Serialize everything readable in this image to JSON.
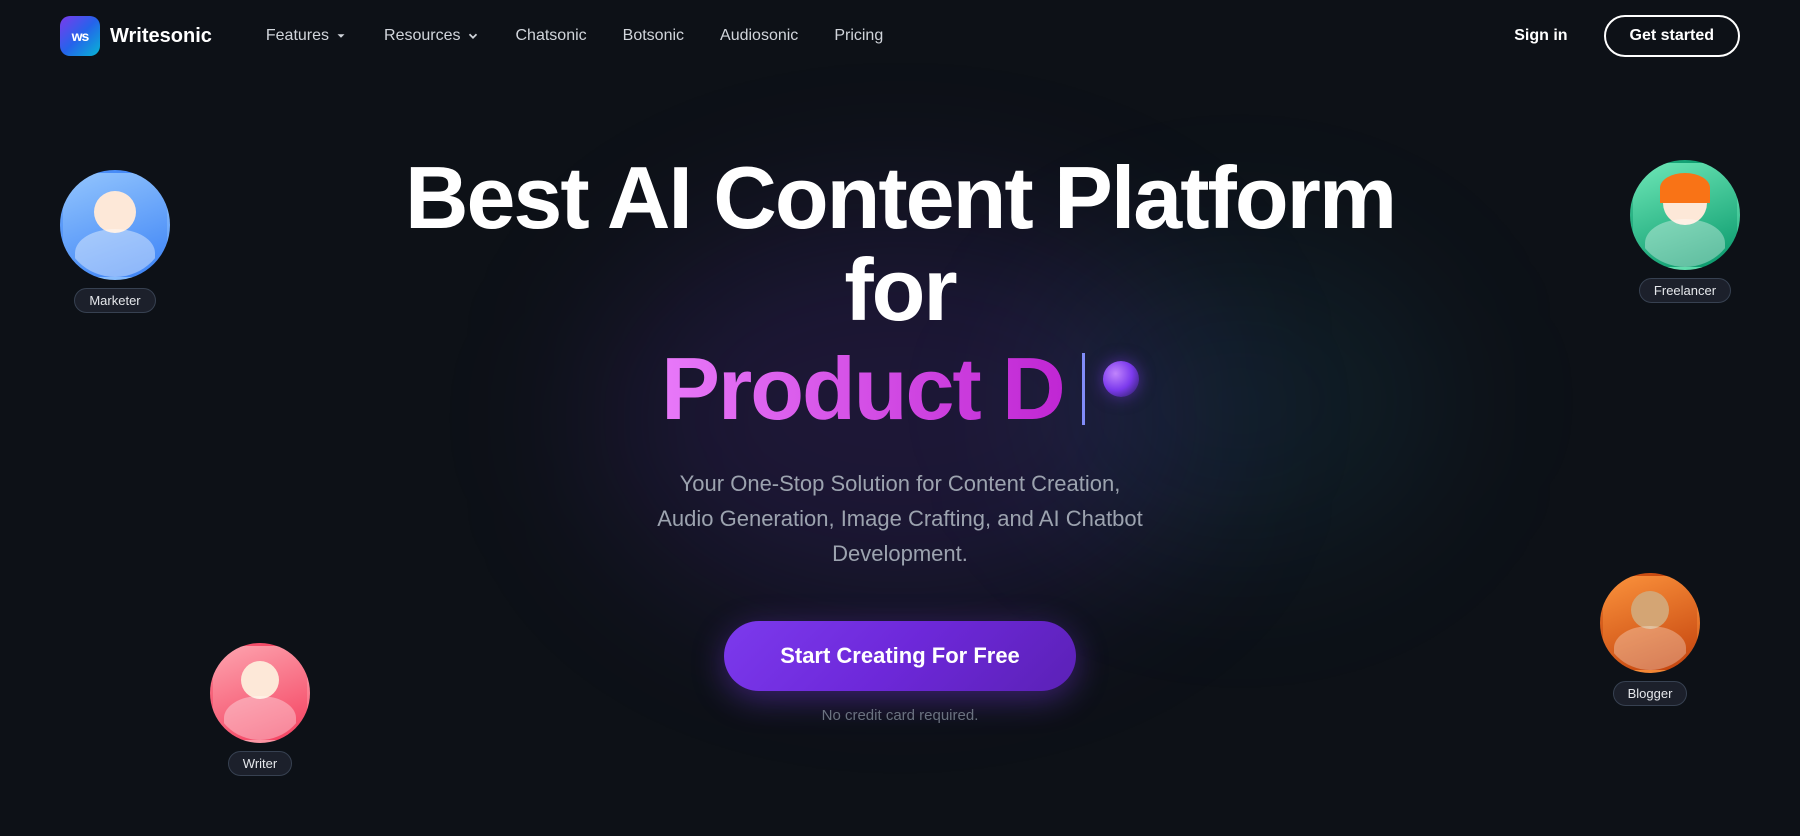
{
  "brand": {
    "logo_initials": "ws",
    "name": "Writesonic"
  },
  "nav": {
    "links": [
      {
        "label": "Features",
        "has_dropdown": true
      },
      {
        "label": "Resources",
        "has_dropdown": true
      },
      {
        "label": "Chatsonic",
        "has_dropdown": false
      },
      {
        "label": "Botsonic",
        "has_dropdown": false
      },
      {
        "label": "Audiosonic",
        "has_dropdown": false
      },
      {
        "label": "Pricing",
        "has_dropdown": false
      }
    ],
    "sign_in": "Sign in",
    "get_started": "Get started"
  },
  "hero": {
    "title_line1": "Best AI Content Platform for",
    "title_line2_pink": "Product D",
    "description_line1": "Your One-Stop Solution for Content Creation,",
    "description_line2": "Audio Generation, Image Crafting, and AI Chatbot Development.",
    "cta_label": "Start Creating For Free",
    "no_credit": "No credit card required."
  },
  "avatars": [
    {
      "id": "marketer",
      "label": "Marketer"
    },
    {
      "id": "writer",
      "label": "Writer"
    },
    {
      "id": "freelancer",
      "label": "Freelancer"
    },
    {
      "id": "blogger",
      "label": "Blogger"
    }
  ]
}
